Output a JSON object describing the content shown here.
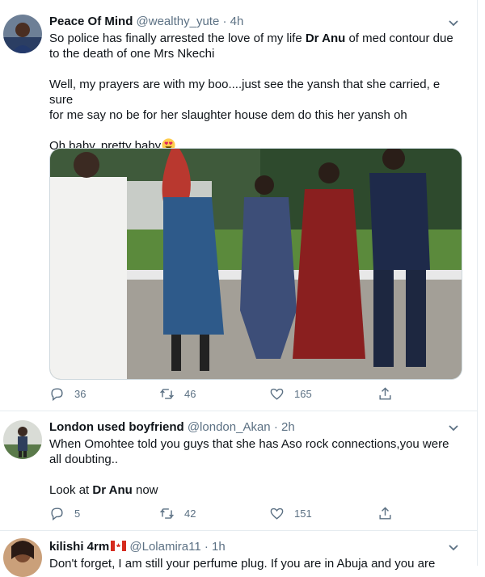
{
  "tweets": [
    {
      "name": "Peace Of Mind",
      "handle": "@wealthy_yute",
      "time": "4h",
      "line1_a": "So police has finally arrested the love of my life ",
      "line1_bold": "Dr Anu",
      "line1_b": " of med contour due",
      "line2": "to the death of one Mrs Nkechi",
      "line3": "Well, my prayers are with my boo....just see the yansh that she carried, e sure",
      "line4": "for me say no be for her slaughter house dem do this her yansh oh",
      "line5": "Oh baby, pretty baby",
      "emoji": "heart-eyes-emoji",
      "replies": "36",
      "retweets": "46",
      "likes": "165"
    },
    {
      "name": "London used boyfriend",
      "handle": "@london_Akan",
      "time": "2h",
      "line1": "When Omohtee told you guys that she has Aso rock connections,you were",
      "line2": "all doubting..",
      "line3_a": "Look at ",
      "line3_bold": "Dr Anu",
      "line3_b": " now",
      "replies": "5",
      "retweets": "42",
      "likes": "151"
    },
    {
      "name": "kilishi 4rm",
      "flag": "canada-flag",
      "handle": "@Lolamira11",
      "time": "1h",
      "line1": "Don't forget, I am still your perfume plug. If you are in Abuja and you are"
    }
  ],
  "separator": "·",
  "colors": {
    "name": "#0f1419",
    "muted": "#5b7083",
    "divider": "#e6ecf0"
  }
}
